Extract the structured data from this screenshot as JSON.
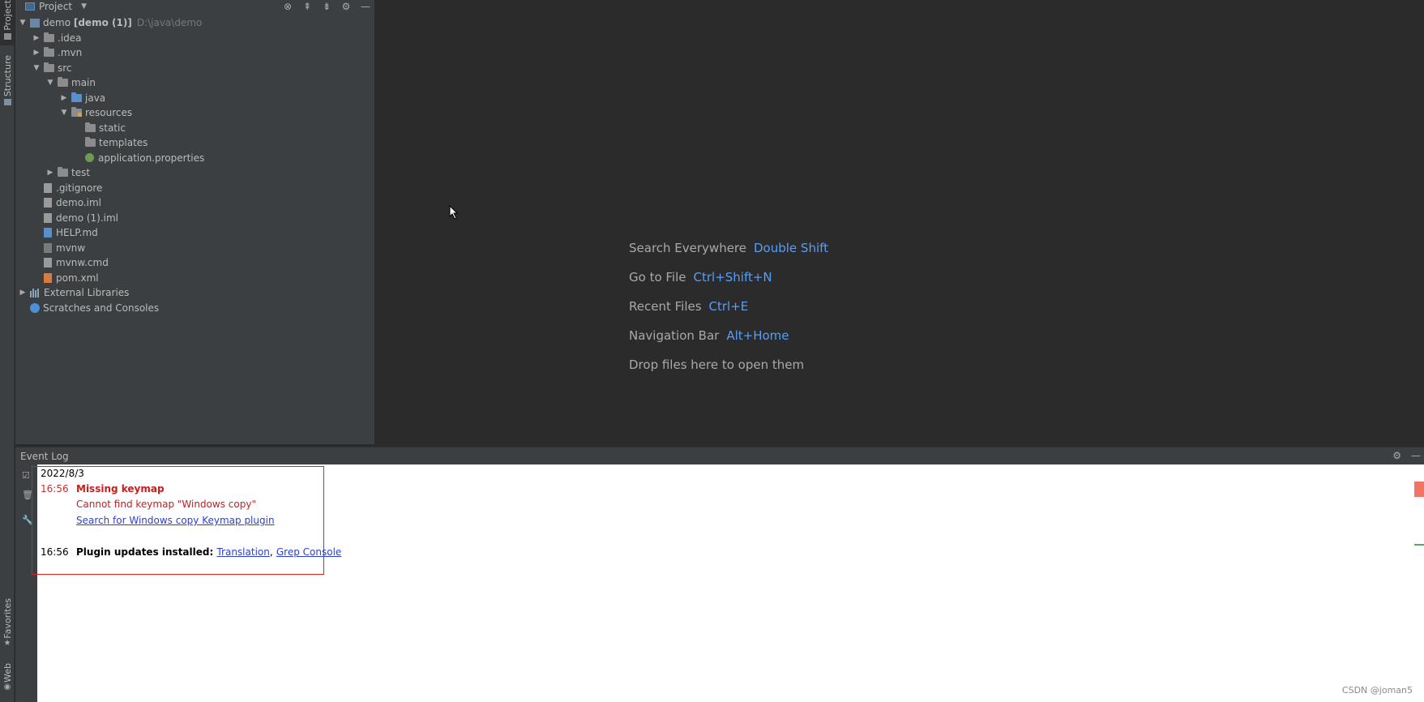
{
  "left_strip": {
    "project_tab": "Project",
    "structure_tab": "Structure",
    "favorites_tab": "Favorites",
    "web_tab": "Web"
  },
  "project_panel": {
    "title": "Project",
    "tree": {
      "root_name": "demo",
      "root_module": "[demo (1)]",
      "root_path": "D:\\java\\demo",
      "idea": ".idea",
      "mvn": ".mvn",
      "src": "src",
      "main": "main",
      "java": "java",
      "resources": "resources",
      "static": "static",
      "templates": "templates",
      "application_properties": "application.properties",
      "test": "test",
      "gitignore": ".gitignore",
      "demo_iml": "demo.iml",
      "demo1_iml": "demo (1).iml",
      "help_md": "HELP.md",
      "mvnw": "mvnw",
      "mvnw_cmd": "mvnw.cmd",
      "pom_xml": "pom.xml",
      "external_libraries": "External Libraries",
      "scratches": "Scratches and Consoles"
    }
  },
  "editor": {
    "hints": [
      {
        "label": "Search Everywhere",
        "key": "Double Shift"
      },
      {
        "label": "Go to File",
        "key": "Ctrl+Shift+N"
      },
      {
        "label": "Recent Files",
        "key": "Ctrl+E"
      },
      {
        "label": "Navigation Bar",
        "key": "Alt+Home"
      },
      {
        "label": "Drop files here to open them",
        "key": ""
      }
    ]
  },
  "event_log": {
    "title": "Event Log",
    "date": "2022/8/3",
    "entry1": {
      "time": "16:56",
      "title": "Missing keymap",
      "message": "Cannot find keymap \"Windows copy\"",
      "link": "Search for Windows copy Keymap plugin"
    },
    "entry2": {
      "time": "16:56",
      "title": "Plugin updates installed:",
      "link1": "Translation",
      "separator": ",",
      "link2": "Grep Console"
    }
  },
  "watermark": "CSDN @joman5",
  "colors": {
    "background": "#2b2b2b",
    "panel": "#3c3f41",
    "shortcut_blue": "#589df6",
    "error_red": "#cc1b1b",
    "link_blue": "#2a3fd6"
  }
}
